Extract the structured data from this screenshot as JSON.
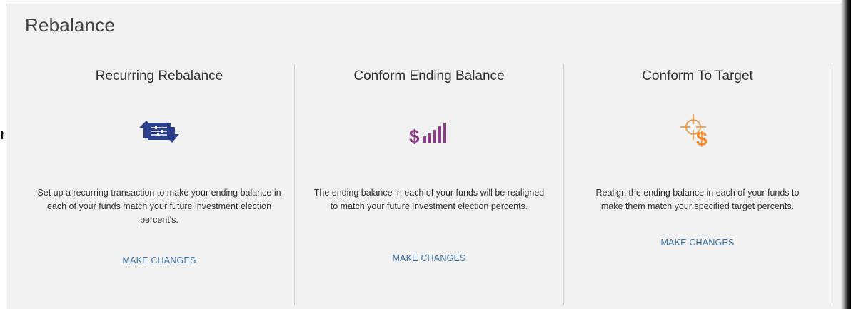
{
  "header": {
    "title": "Rebalance"
  },
  "left_fragment": "n",
  "options": [
    {
      "heading": "Recurring Rebalance",
      "icon": "recurring-transfer-icon",
      "description": "Set up a recurring transaction to make your ending balance in each of your funds match your future investment election percent's.",
      "link": "MAKE CHANGES",
      "color": "#2b3f8c"
    },
    {
      "heading": "Conform Ending Balance",
      "icon": "dollar-signal-bars-icon",
      "description": "The ending balance in each of your funds will be realigned to match your future investment election percents.",
      "link": "MAKE CHANGES",
      "color": "#8e3b8a"
    },
    {
      "heading": "Conform To Target",
      "icon": "target-dollar-icon",
      "description": "Realign the ending balance in each of your funds to make them match your specified target percents.",
      "link": "MAKE CHANGES",
      "color": "#f08a2c"
    }
  ]
}
